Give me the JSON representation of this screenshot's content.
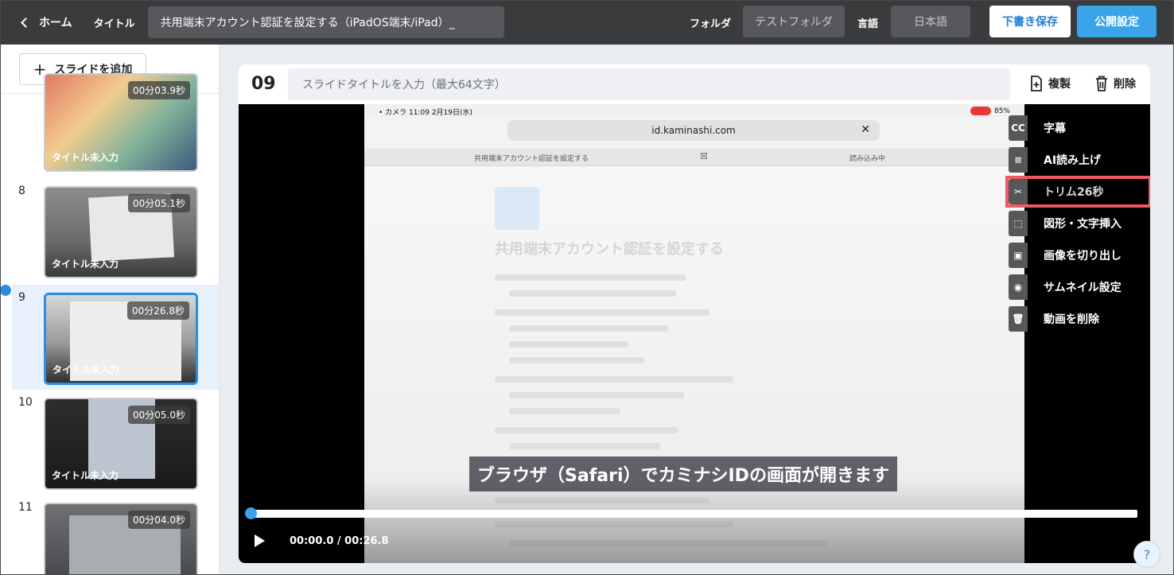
{
  "header": {
    "home_label": "ホーム",
    "title_label": "タイトル",
    "title_value": "共用端末アカウント認証を設定する（iPadOS端末/iPad）_",
    "folder_label": "フォルダ",
    "folder_value": "テストフォルダ",
    "language_label": "言語",
    "language_value": "日本語",
    "save_draft_label": "下書き保存",
    "publish_label": "公開設定"
  },
  "sidebar": {
    "add_slide_label": "スライドを追加",
    "slides": [
      {
        "number": "",
        "duration": "00分03.9秒",
        "title": "タイトル未入力"
      },
      {
        "number": "8",
        "duration": "00分05.1秒",
        "title": "タイトル未入力"
      },
      {
        "number": "9",
        "duration": "00分26.8秒",
        "title": "タイトル未入力"
      },
      {
        "number": "10",
        "duration": "00分05.0秒",
        "title": "タイトル未入力"
      },
      {
        "number": "11",
        "duration": "00分04.0秒",
        "title": ""
      }
    ]
  },
  "editor": {
    "slide_number": "09",
    "slide_title_placeholder": "スライドタイトルを入力（最大64文字）",
    "duplicate_label": "複製",
    "delete_label": "削除"
  },
  "video": {
    "status_left": "• カメラ  11:09  2月19日(水)",
    "status_right": "85%",
    "url": "id.kaminashi.com",
    "tab1_label": "共用端末アカウント認証を設定する",
    "tab2_label": "読み込み中",
    "doc_heading": "共用端末アカウント認証を設定する",
    "caption": "ブラウザ（Safari）でカミナシIDの画面が開きます",
    "timecode": "00:00.0 / 00:26.8",
    "progress": 0.0
  },
  "actions": {
    "items": [
      {
        "label": "字幕",
        "icon": "CC"
      },
      {
        "label": "AI読み上げ",
        "icon": "≡"
      },
      {
        "label": "トリム26秒",
        "icon": "✂"
      },
      {
        "label": "図形・文字挿入",
        "icon": "⬚"
      },
      {
        "label": "画像を切り出し",
        "icon": "▣"
      },
      {
        "label": "サムネイル設定",
        "icon": "◉"
      },
      {
        "label": "動画を削除",
        "icon": "🗑"
      }
    ]
  },
  "help_label": "?",
  "colors": {
    "accent": "#3aa3ea",
    "highlight": "#ef5a60",
    "topbar": "#3a3b3d"
  }
}
